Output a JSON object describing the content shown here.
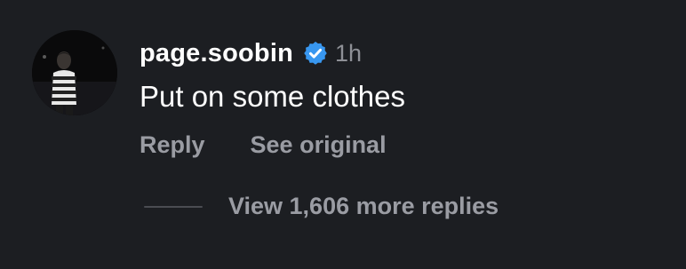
{
  "comment": {
    "username": "page.soobin",
    "verified_icon": "verified-badge-icon",
    "timestamp": "1h",
    "text": "Put on some clothes",
    "avatar": "profile-photo",
    "actions": {
      "reply_label": "Reply",
      "see_original_label": "See original"
    },
    "more_replies_label": "View 1,606 more replies"
  },
  "colors": {
    "background": "#1c1e22",
    "username": "#ffffff",
    "body_text": "#ffffff",
    "muted_text": "#9a9ca3",
    "verified_blue": "#3897f0"
  }
}
